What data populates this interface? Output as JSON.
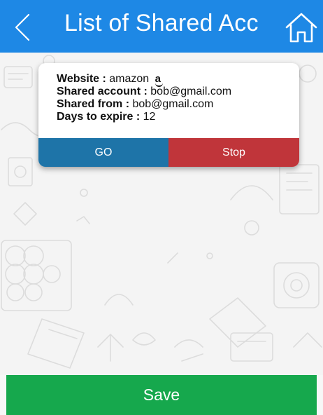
{
  "header": {
    "title": "List of Shared Acc",
    "back_icon": "chevron-left-icon",
    "home_icon": "home-icon"
  },
  "card": {
    "website_label": "Website :",
    "website_value": "amazon",
    "website_logo": "a",
    "shared_account_label": "Shared account :",
    "shared_account_value": "bob@gmail.com",
    "shared_from_label": "Shared from :",
    "shared_from_value": "bob@gmail.com",
    "days_label": "Days to expire :",
    "days_value": "12",
    "go_label": "GO",
    "stop_label": "Stop"
  },
  "footer": {
    "save_label": "Save"
  },
  "colors": {
    "header": "#1e88e5",
    "go": "#1e74a8",
    "stop": "#c0353a",
    "save": "#16a84d"
  }
}
